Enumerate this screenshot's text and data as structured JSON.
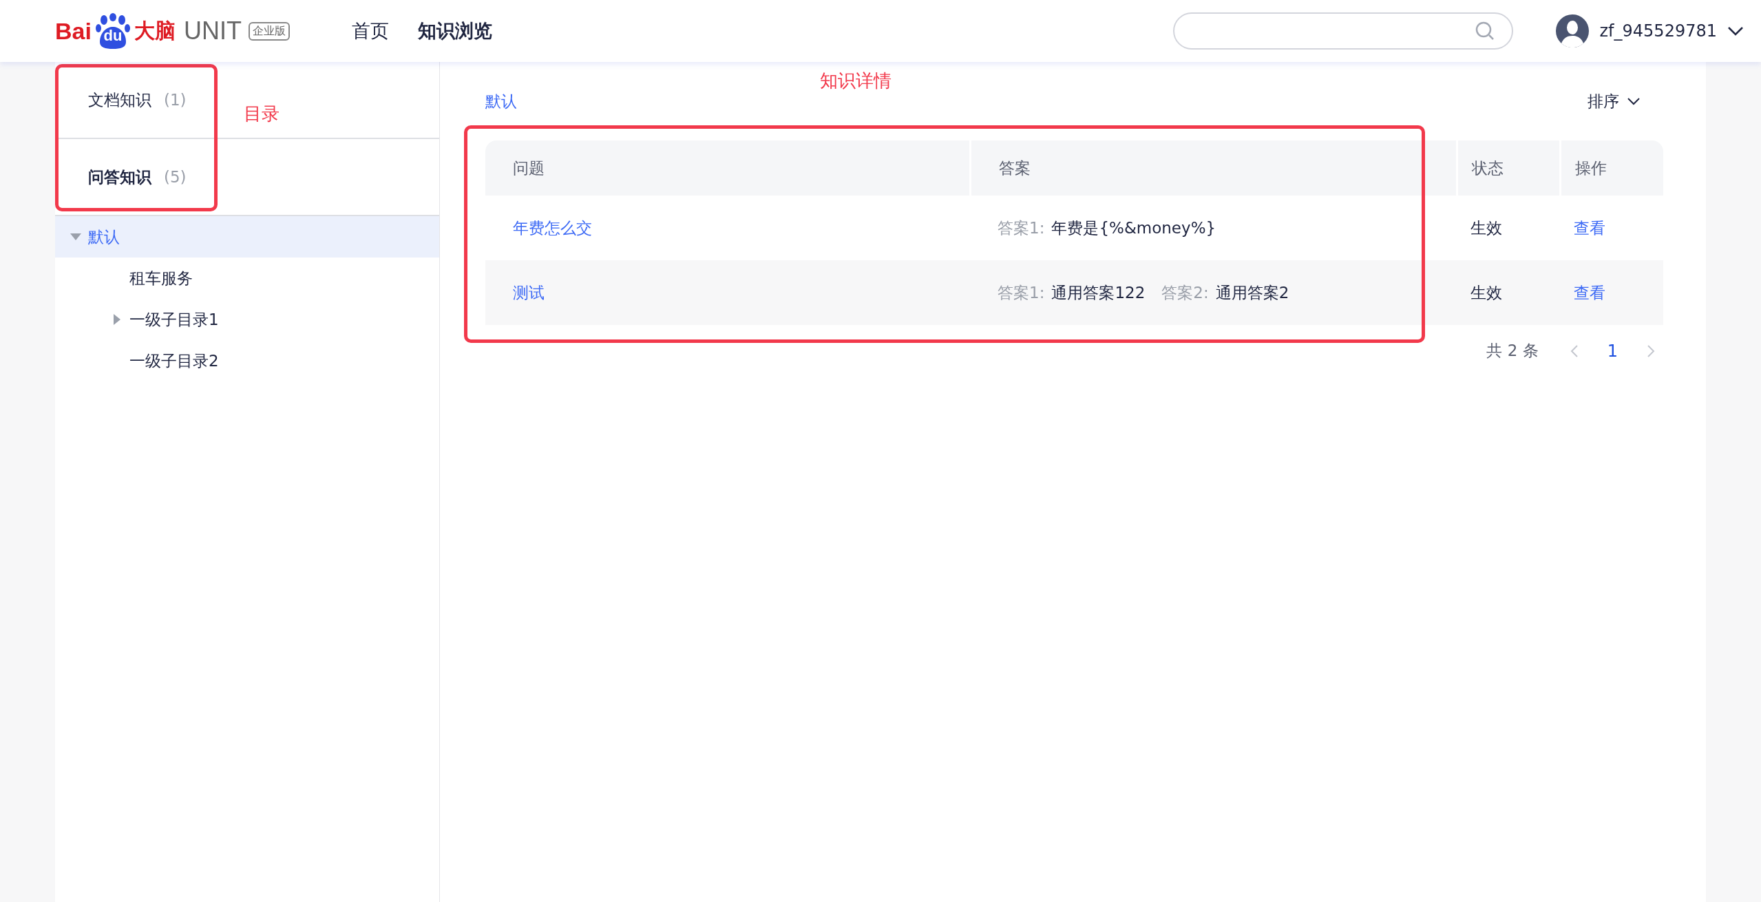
{
  "header": {
    "logo": {
      "brand": "Bai",
      "paw_text": "du",
      "product": "大脑",
      "name": "UNIT",
      "edition": "企业版"
    },
    "nav": [
      {
        "label": "首页",
        "selected": false
      },
      {
        "label": "知识浏览",
        "selected": true
      }
    ],
    "user": {
      "name": "zf_945529781"
    }
  },
  "sidebar": {
    "tabs": [
      {
        "label": "文档知识",
        "count": "(1)",
        "selected": false
      },
      {
        "label": "问答知识",
        "count": "(5)",
        "selected": true
      }
    ],
    "tree": [
      {
        "label": "默认",
        "expanded": true,
        "selected": true,
        "children": [
          {
            "label": "租车服务",
            "selected": false
          },
          {
            "label": "一级子目录1",
            "expanded": false,
            "selected": false
          },
          {
            "label": "一级子目录2",
            "selected": false
          }
        ]
      }
    ]
  },
  "main": {
    "breadcrumb": "默认",
    "sort": "排序",
    "table": {
      "columns": [
        "问题",
        "答案",
        "状态",
        "操作"
      ],
      "rows": [
        {
          "question": "年费怎么交",
          "answers": [
            {
              "label": "答案1:",
              "text": "年费是{%&money%}"
            }
          ],
          "status": "生效",
          "action": "查看"
        },
        {
          "question": "测试",
          "answers": [
            {
              "label": "答案1:",
              "text": "通用答案122"
            },
            {
              "label": "答案2:",
              "text": "通用答案2"
            }
          ],
          "status": "生效",
          "action": "查看"
        }
      ]
    },
    "pagination": {
      "total": "共 2 条",
      "pages": [
        {
          "label": "1",
          "selected": true
        }
      ]
    }
  },
  "annotations": [
    {
      "label": "目录"
    },
    {
      "label": "知识详情"
    }
  ]
}
